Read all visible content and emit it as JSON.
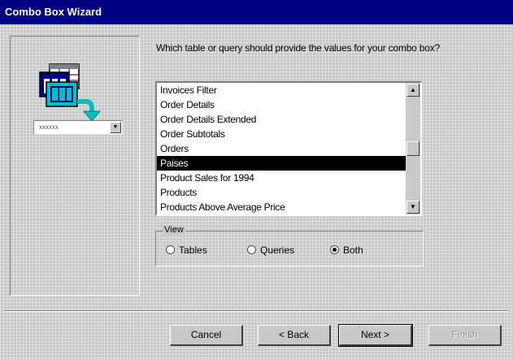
{
  "window": {
    "title": "Combo Box Wizard"
  },
  "illustration": {
    "combo_value": "xxxxxx"
  },
  "question": "Which table or query should provide the values for your combo box?",
  "list": {
    "items": [
      "Invoices Filter",
      "Order Details",
      "Order Details Extended",
      "Order Subtotals",
      "Orders",
      "Paises",
      "Product Sales for 1994",
      "Products",
      "Products Above Average Price"
    ],
    "selected_index": 5
  },
  "view": {
    "legend": "View",
    "options": [
      {
        "label": "Tables",
        "checked": false
      },
      {
        "label": "Queries",
        "checked": false
      },
      {
        "label": "Both",
        "checked": true
      }
    ]
  },
  "buttons": {
    "cancel": "Cancel",
    "back": "< Back",
    "next": "Next >",
    "finish": "Finish"
  },
  "colors": {
    "title_bar": "#000080",
    "dialog": "#c8c8c8",
    "illustration_teal": "#00c0c0",
    "illustration_navy": "#000080"
  }
}
